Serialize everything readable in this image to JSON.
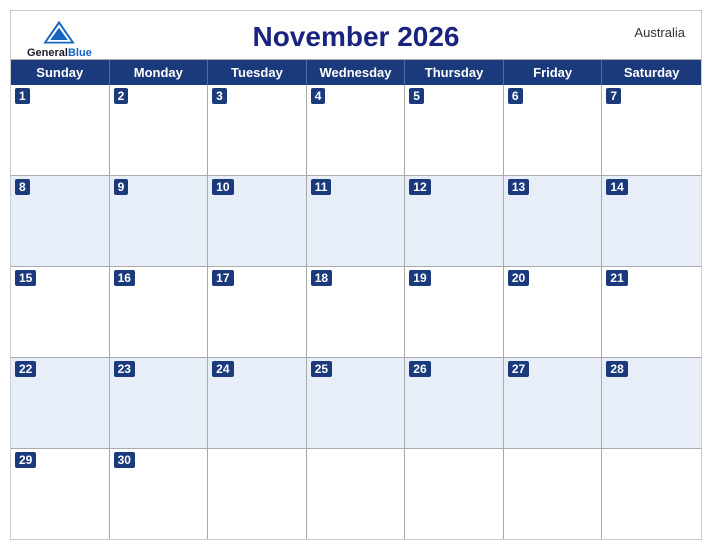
{
  "header": {
    "title": "November 2026",
    "country": "Australia",
    "logo": {
      "general": "General",
      "blue": "Blue"
    }
  },
  "days_of_week": [
    "Sunday",
    "Monday",
    "Tuesday",
    "Wednesday",
    "Thursday",
    "Friday",
    "Saturday"
  ],
  "weeks": [
    [
      1,
      2,
      3,
      4,
      5,
      6,
      7
    ],
    [
      8,
      9,
      10,
      11,
      12,
      13,
      14
    ],
    [
      15,
      16,
      17,
      18,
      19,
      20,
      21
    ],
    [
      22,
      23,
      24,
      25,
      26,
      27,
      28
    ],
    [
      29,
      30,
      null,
      null,
      null,
      null,
      null
    ]
  ]
}
